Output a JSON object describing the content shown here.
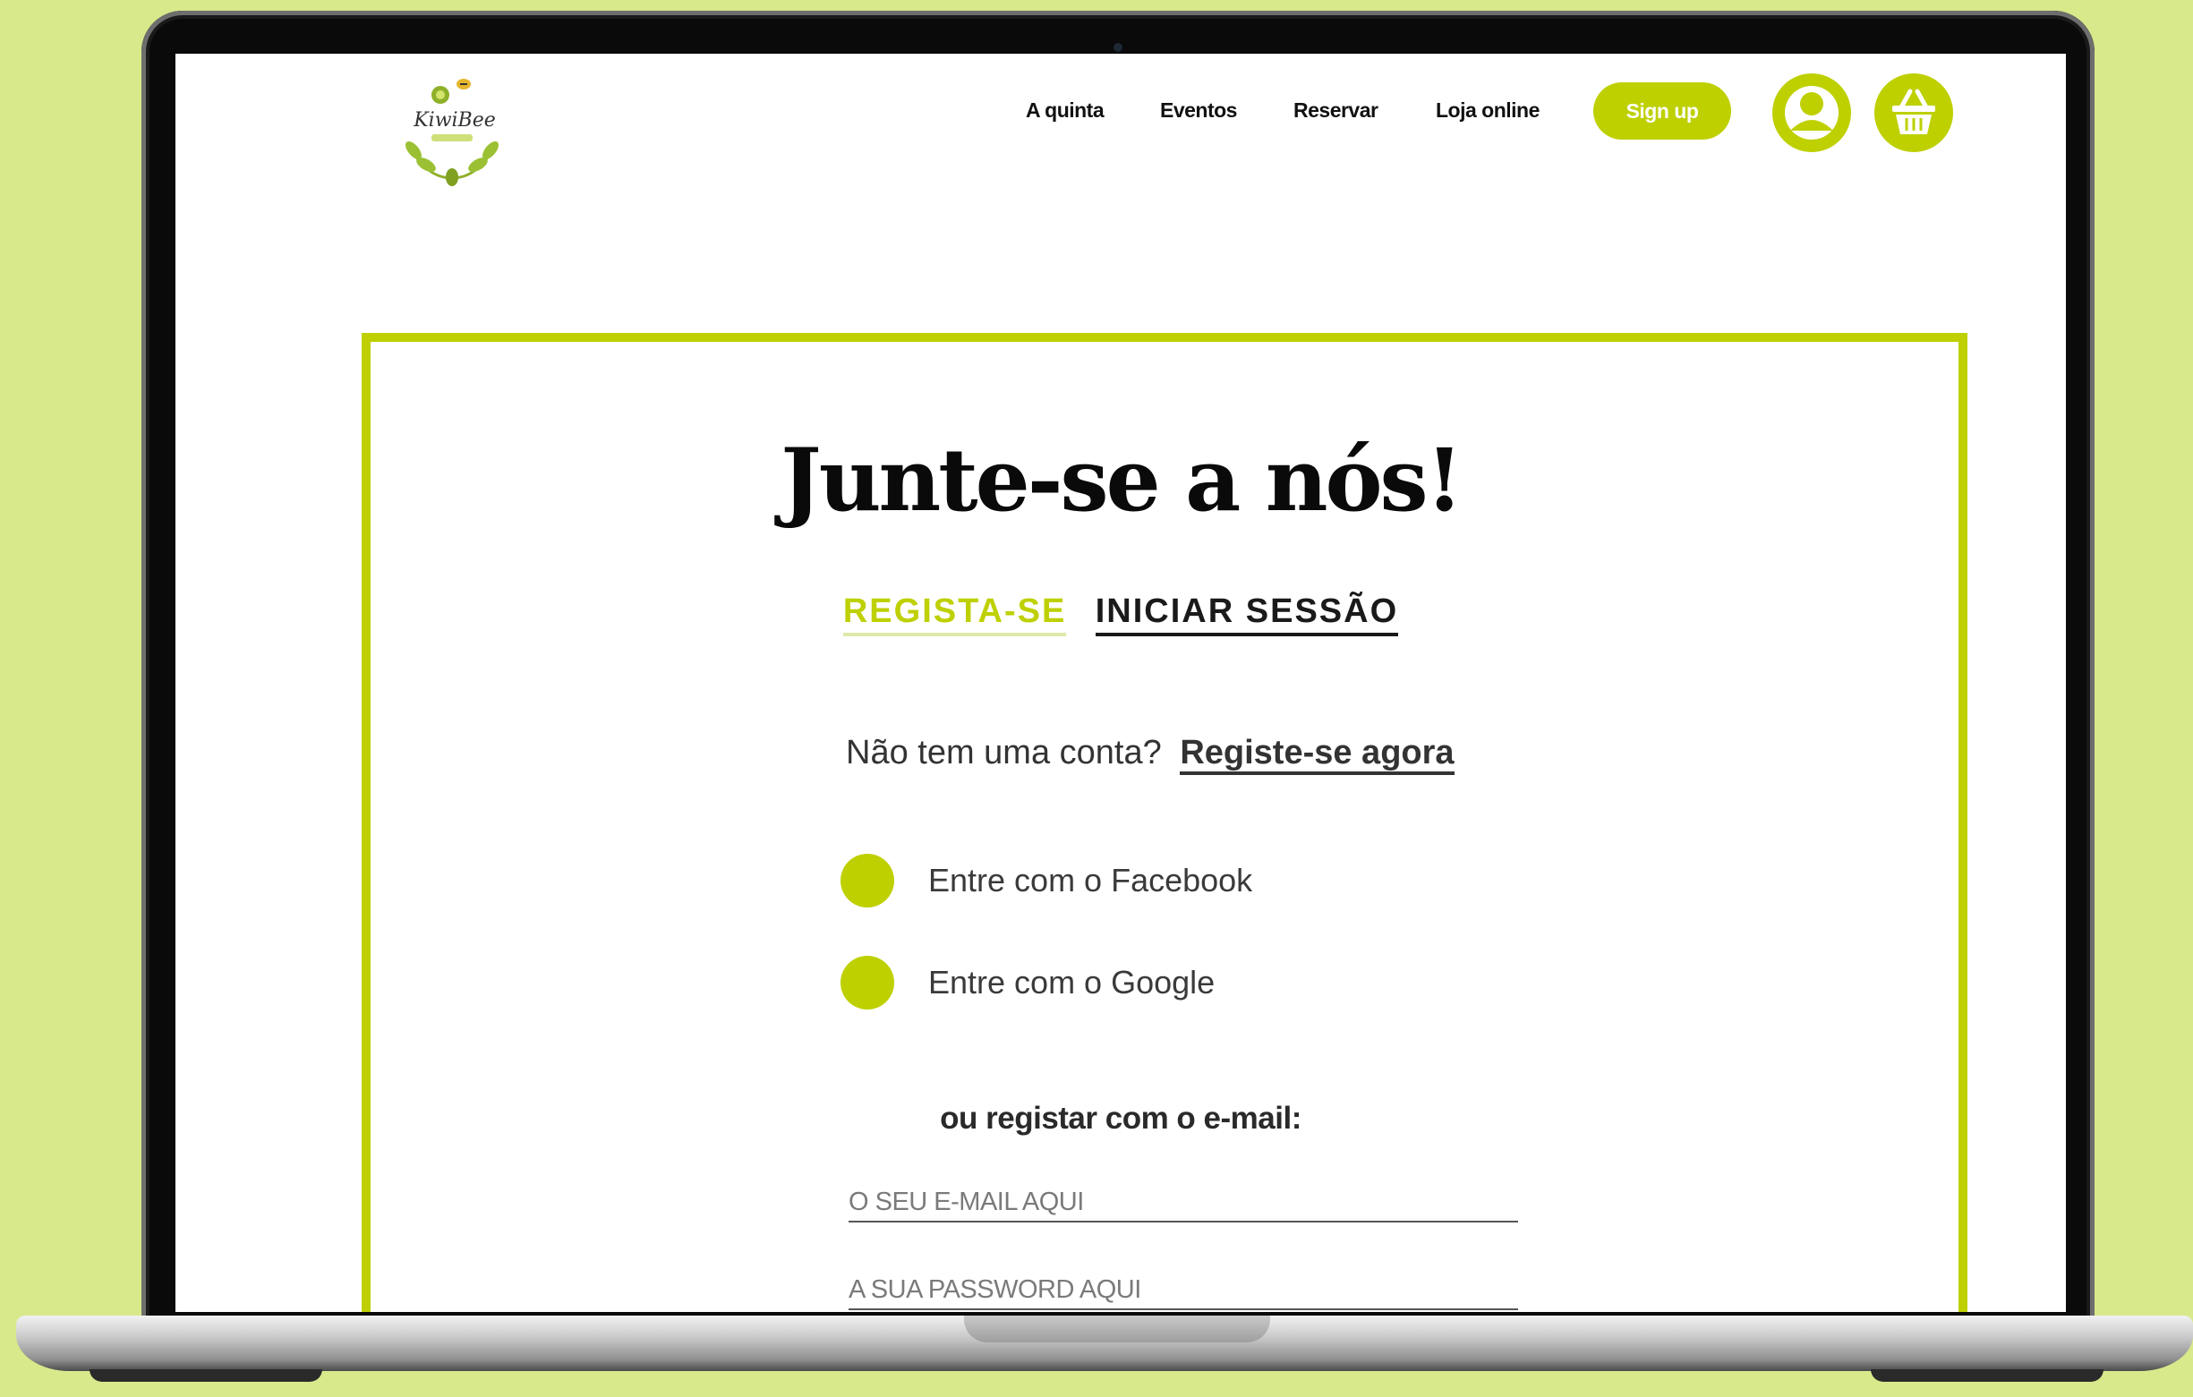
{
  "brand": {
    "logo_text": "KiwiBee",
    "accent_color": "#bed000",
    "background_color": "#d7e98b"
  },
  "nav": {
    "items": [
      "A quinta",
      "Eventos",
      "Reservar",
      "Loja online"
    ],
    "signup_label": "Sign up",
    "profile_icon": "user-icon",
    "cart_icon": "basket-icon"
  },
  "auth": {
    "title": "Junte-se a nós!",
    "tabs": [
      {
        "label": "REGISTA-SE",
        "active": true
      },
      {
        "label": "INICIAR SESSÃO",
        "active": false
      }
    ],
    "no_account_text": "Não tem uma conta?",
    "register_link": "Registe-se agora",
    "social": [
      {
        "label": "Entre com o Facebook",
        "icon": "facebook-icon"
      },
      {
        "label": "Entre com o Google",
        "icon": "google-icon"
      }
    ],
    "email_divider": "ou registar com o e-mail:",
    "email_placeholder": "O SEU E-MAIL AQUI",
    "password_placeholder": "A SUA PASSWORD AQUI"
  }
}
